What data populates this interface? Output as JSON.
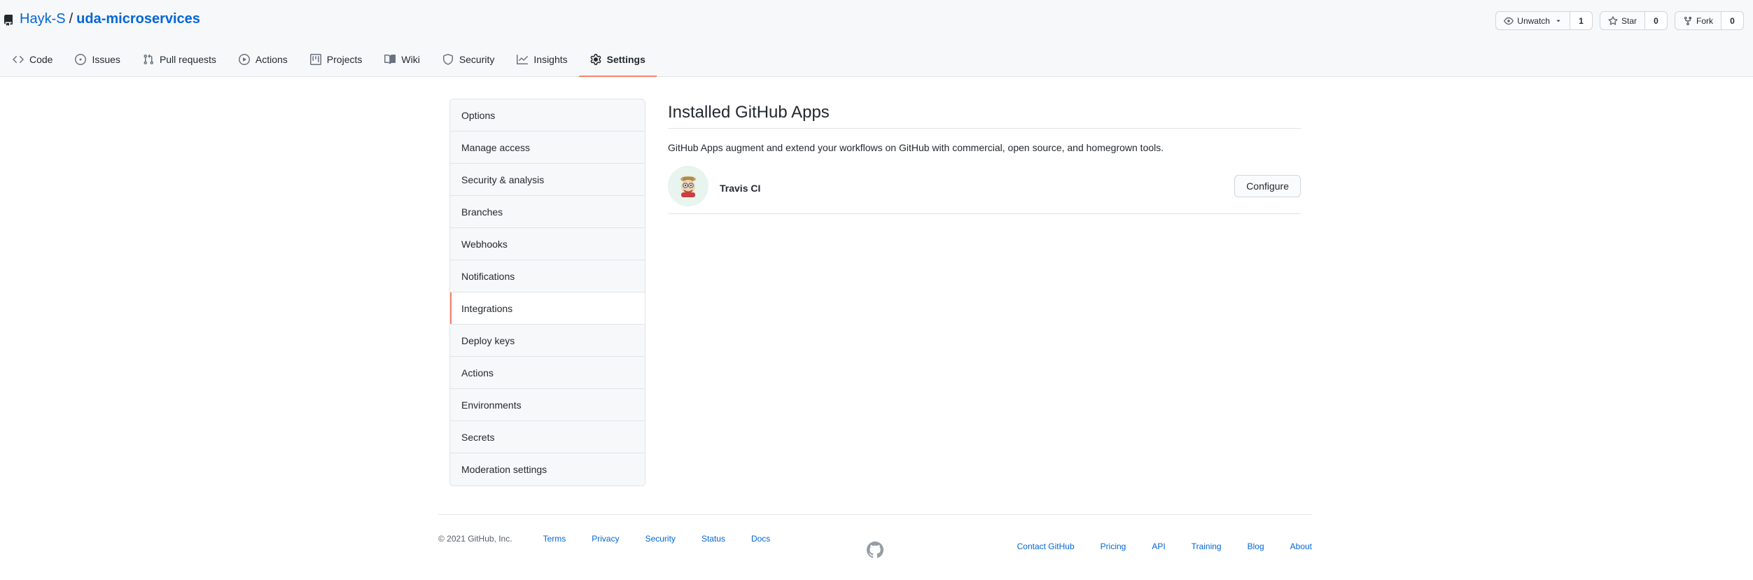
{
  "repo": {
    "owner": "Hayk-S",
    "separator": "/",
    "name": "uda-microservices"
  },
  "actions": {
    "watch_label": "Unwatch",
    "watch_count": "1",
    "star_label": "Star",
    "star_count": "0",
    "fork_label": "Fork",
    "fork_count": "0"
  },
  "nav": {
    "code": "Code",
    "issues": "Issues",
    "pulls": "Pull requests",
    "actions": "Actions",
    "projects": "Projects",
    "wiki": "Wiki",
    "security": "Security",
    "insights": "Insights",
    "settings": "Settings"
  },
  "menu": {
    "options": "Options",
    "manage_access": "Manage access",
    "security_analysis": "Security & analysis",
    "branches": "Branches",
    "webhooks": "Webhooks",
    "notifications": "Notifications",
    "integrations": "Integrations",
    "deploy_keys": "Deploy keys",
    "actions": "Actions",
    "environments": "Environments",
    "secrets": "Secrets",
    "moderation": "Moderation settings"
  },
  "content": {
    "heading": "Installed GitHub Apps",
    "description": "GitHub Apps augment and extend your workflows on GitHub with commercial, open source, and homegrown tools.",
    "app_name": "Travis CI",
    "configure_label": "Configure"
  },
  "footer": {
    "copyright": "© 2021 GitHub, Inc.",
    "terms": "Terms",
    "privacy": "Privacy",
    "security": "Security",
    "status": "Status",
    "docs": "Docs",
    "contact": "Contact GitHub",
    "pricing": "Pricing",
    "api": "API",
    "training": "Training",
    "blog": "Blog",
    "about": "About"
  },
  "colors": {
    "link": "#0366d6",
    "accent_underline": "#f9826c",
    "border": "#e1e4e8",
    "header_bg": "#f6f8fa"
  }
}
